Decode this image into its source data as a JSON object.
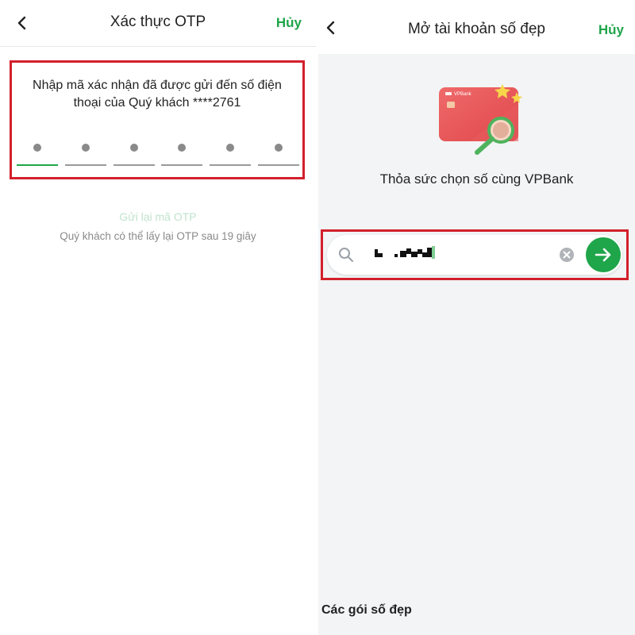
{
  "otp_screen": {
    "title": "Xác thực OTP",
    "cancel_label": "Hủy",
    "back_icon": "chevron-left-icon",
    "message": "Nhập mã xác nhận đã được gửi đến số điện thoại của Quý khách ****2761",
    "digit_count": 6,
    "active_index": 0,
    "resend_label": "Gửi lại mã OTP",
    "resend_note": "Quý khách có thể lấy lại OTP sau 19 giây",
    "colors": {
      "accent": "#1fa54a",
      "highlight_border": "#d2202b",
      "resend_disabled": "#bfe3cc"
    }
  },
  "account_screen": {
    "title": "Mở tài khoản số đẹp",
    "cancel_label": "Hủy",
    "back_icon": "chevron-left-icon",
    "card_brand": "VPBank",
    "promo_text": "Thỏa sức chọn số cùng VPBank",
    "search_icon": "search-icon",
    "search_value_masked": true,
    "clear_icon": "clear-icon",
    "go_icon": "arrow-right-icon",
    "packages_heading": "Các gói số đẹp",
    "colors": {
      "accent": "#1fa54a",
      "background": "#f2f4f5",
      "card": "#e85d5d"
    }
  }
}
